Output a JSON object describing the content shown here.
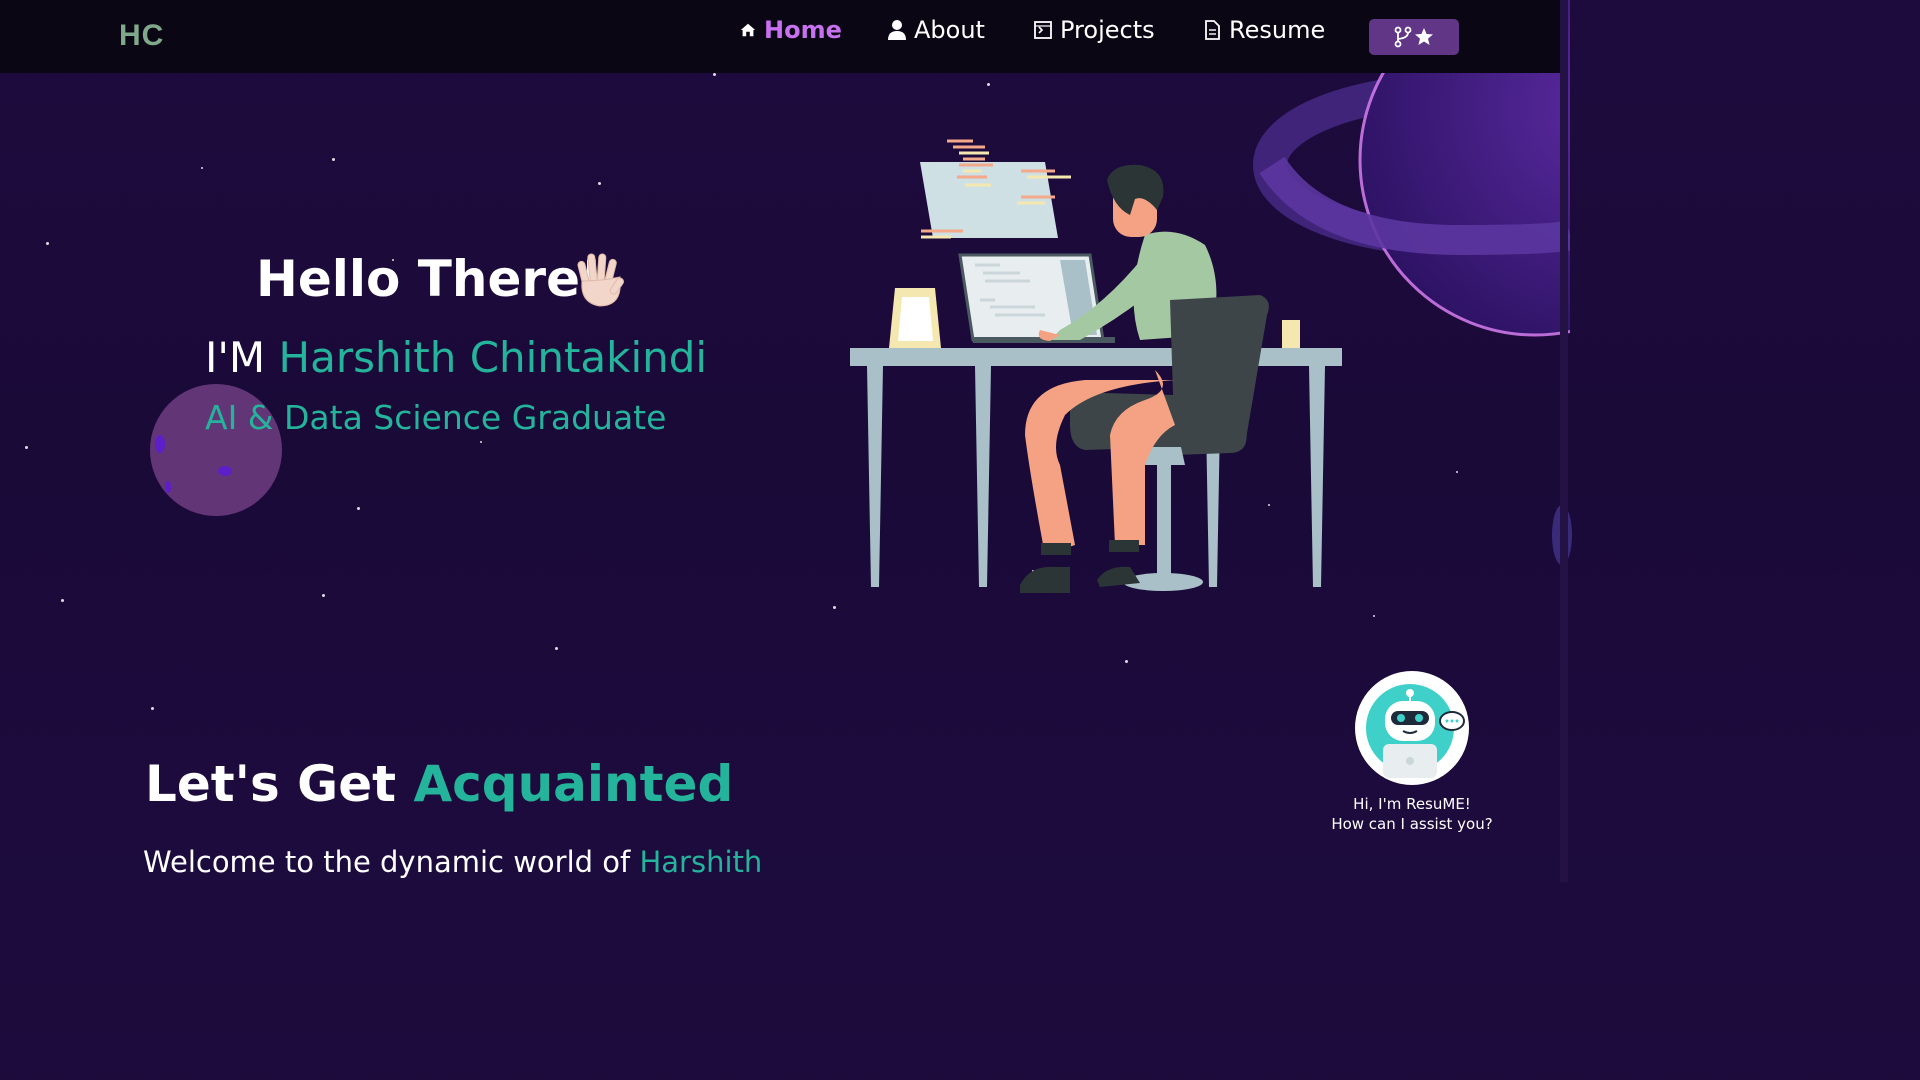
{
  "navbar": {
    "logo": "HC",
    "items": [
      {
        "label": "Home",
        "icon": "home-icon",
        "active": true
      },
      {
        "label": "About",
        "icon": "user-icon",
        "active": false
      },
      {
        "label": "Projects",
        "icon": "projects-icon",
        "active": false
      },
      {
        "label": "Resume",
        "icon": "document-icon",
        "active": false
      }
    ],
    "github_button_icons": [
      "fork-icon",
      "star-icon"
    ]
  },
  "hero": {
    "greeting": "Hello There!",
    "intro_prefix": "I'M",
    "name": "Harshith Chintakindi",
    "role": "AI & Data Science Graduate"
  },
  "about": {
    "title_prefix": "Let's Get",
    "title_highlight": "Acquainted",
    "welcome_prefix": "Welcome to the dynamic world of",
    "welcome_highlight": "Harshith"
  },
  "chatbot": {
    "line1": "Hi, I'm ResuME!",
    "line2": "How can I assist you?"
  },
  "colors": {
    "background": "#1b0a3a",
    "navbar": "#0b0614",
    "accent_teal": "#24b39b",
    "accent_purple": "#c770f0",
    "button_purple": "#623686"
  }
}
